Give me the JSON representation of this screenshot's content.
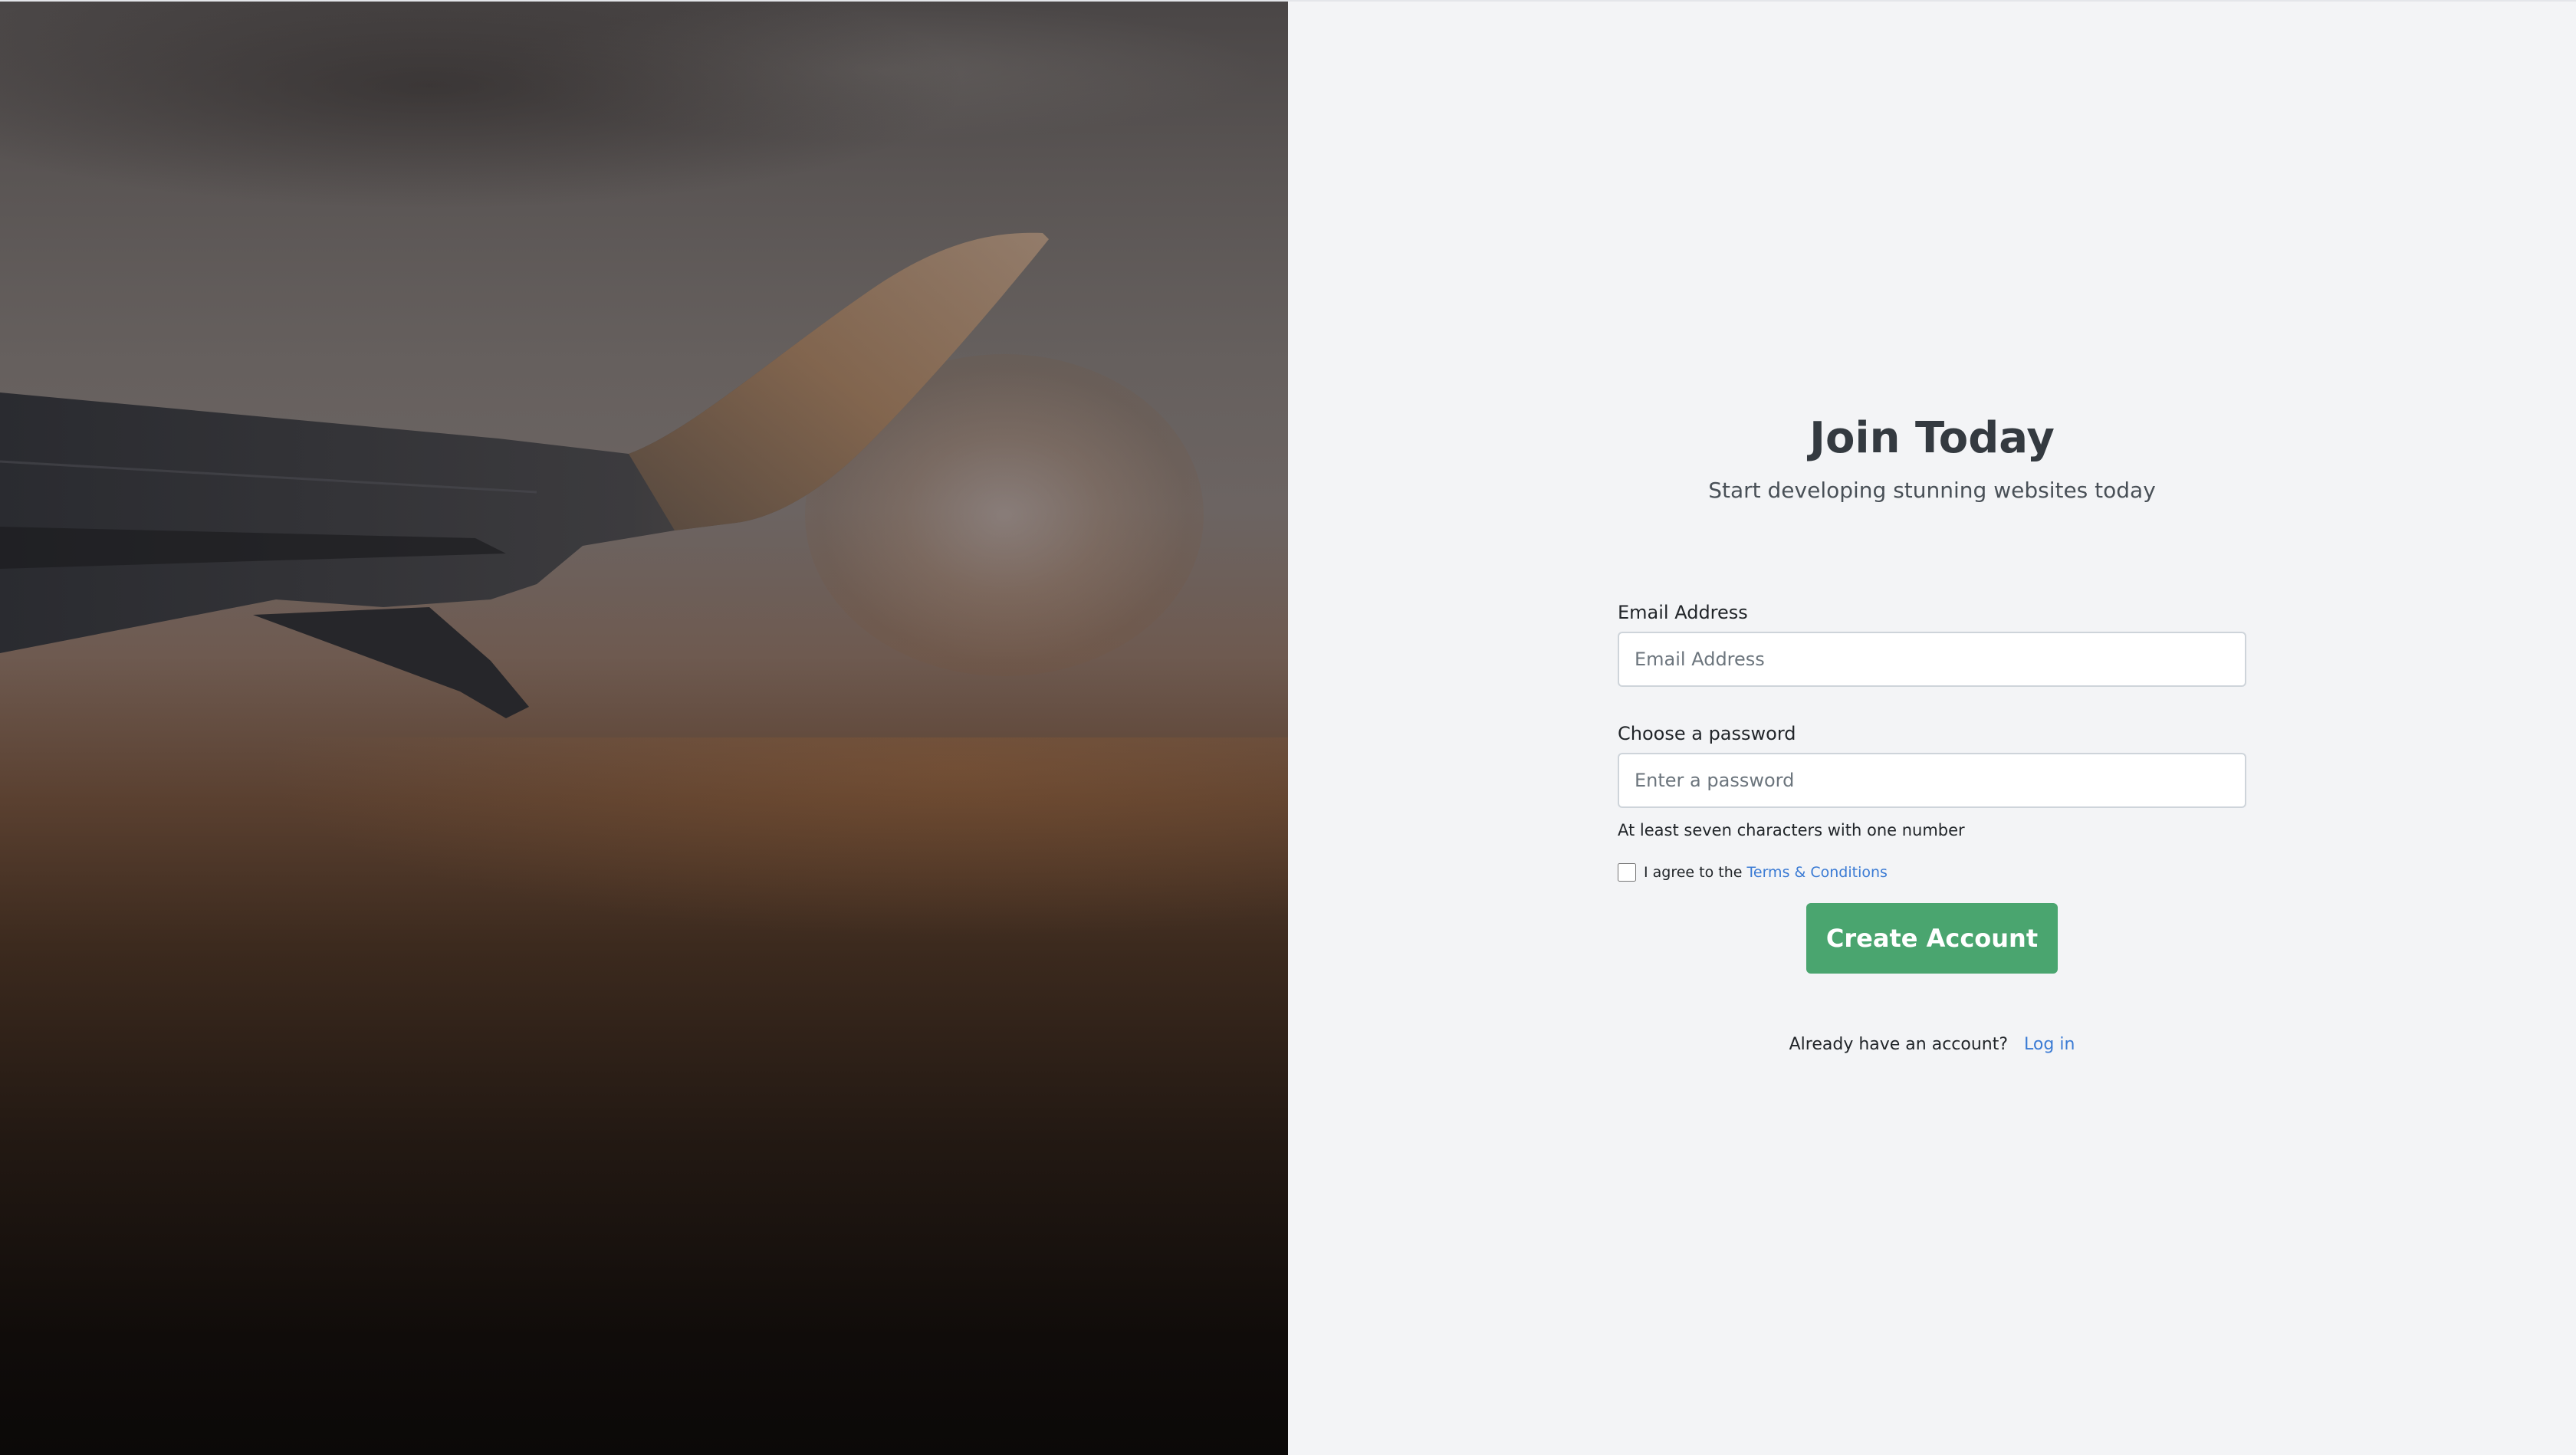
{
  "hero": {
    "image_alt": "Airplane wing over clouds at sunset"
  },
  "form": {
    "title": "Join Today",
    "subtitle": "Start developing stunning websites today",
    "email": {
      "label": "Email Address",
      "placeholder": "Email Address",
      "value": ""
    },
    "password": {
      "label": "Choose a password",
      "placeholder": "Enter a password",
      "value": "",
      "hint": "At least seven characters with one number"
    },
    "terms": {
      "checked": false,
      "prefix": "I agree to the",
      "link_label": "Terms & Conditions"
    },
    "submit_label": "Create Account",
    "login_prompt": {
      "text": "Already have an account?",
      "link_label": "Log in"
    }
  },
  "colors": {
    "primary_button": "#4aa56f",
    "link": "#3b7bd4",
    "form_background": "#f3f4f6",
    "heading": "#343a40"
  }
}
